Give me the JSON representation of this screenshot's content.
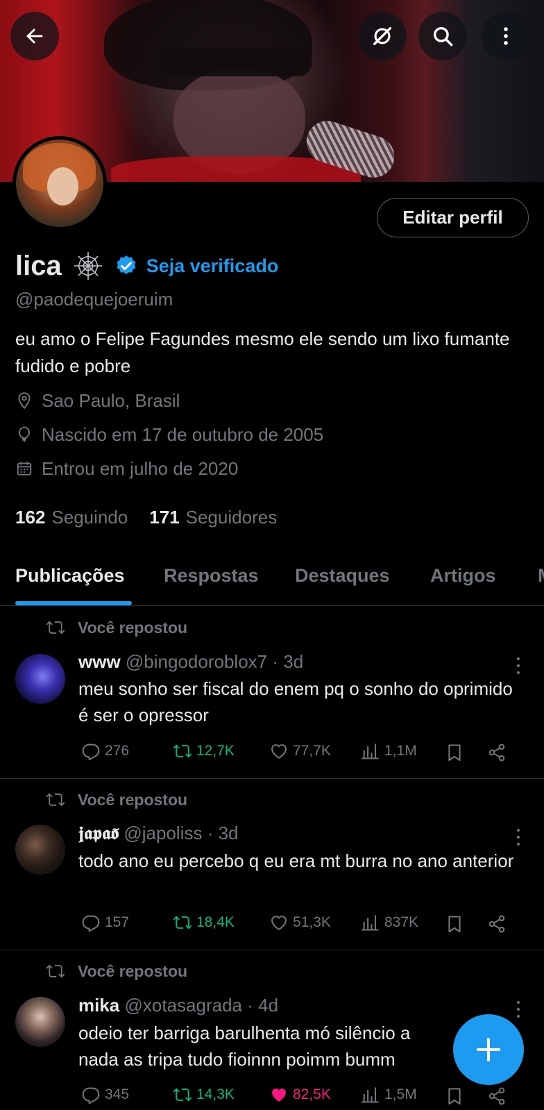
{
  "header": {
    "back_icon": "arrow-left-icon",
    "grok_icon": "grok-slash-icon",
    "search_icon": "search-icon",
    "more_icon": "more-vertical-icon"
  },
  "profile": {
    "name": "lica",
    "name_emoji": "spider-web-icon",
    "verify_label": "Seja verificado",
    "handle": "@paodequejoeruim",
    "bio": "eu amo o Felipe Fagundes mesmo ele sendo um lixo fumante fudido e pobre",
    "location": "Sao Paulo, Brasil",
    "birthday": "Nascido em 17 de outubro de 2005",
    "joined": "Entrou em julho de 2020",
    "following_count": "162",
    "following_label": "Seguindo",
    "followers_count": "171",
    "followers_label": "Seguidores",
    "edit_label": "Editar perfil"
  },
  "tabs": [
    {
      "label": "Publicações",
      "active": true
    },
    {
      "label": "Respostas",
      "active": false
    },
    {
      "label": "Destaques",
      "active": false
    },
    {
      "label": "Artigos",
      "active": false
    },
    {
      "label": "M",
      "active": false
    }
  ],
  "posts": [
    {
      "repost_label": "Você repostou",
      "name": "www",
      "handle": "@bingodoroblox7",
      "time": "· 3d",
      "text": "meu sonho ser fiscal do enem pq o sonho do oprimido é ser o opressor",
      "replies": "276",
      "reposts": "12,7K",
      "likes": "77,7K",
      "views": "1,1M",
      "reposted": true,
      "liked": false
    },
    {
      "repost_label": "Você repostou",
      "name": "𝖏𝖆𝖕𝖆𝖔̃",
      "handle": "@japoliss",
      "time": "· 3d",
      "text": "todo ano eu percebo q eu era mt burra no ano anterior",
      "replies": "157",
      "reposts": "18,4K",
      "likes": "51,3K",
      "views": "837K",
      "reposted": true,
      "liked": false
    },
    {
      "repost_label": "Você repostou",
      "name": "mika",
      "handle": "@xotasagrada",
      "time": "· 4d",
      "text": "odeio ter barriga barulhenta mó silêncio a nada as tripa tudo fioinnn poimm bumm",
      "replies": "345",
      "reposts": "14,3K",
      "likes": "82,5K",
      "views": "1,5M",
      "reposted": true,
      "liked": true
    }
  ],
  "fab_icon": "compose-plus-icon",
  "colors": {
    "accent": "#1d9bf0",
    "repost_green": "#00ba7c",
    "like_pink": "#f91880",
    "muted": "#71767b",
    "text": "#e7e9ea",
    "border": "#2f3336"
  }
}
